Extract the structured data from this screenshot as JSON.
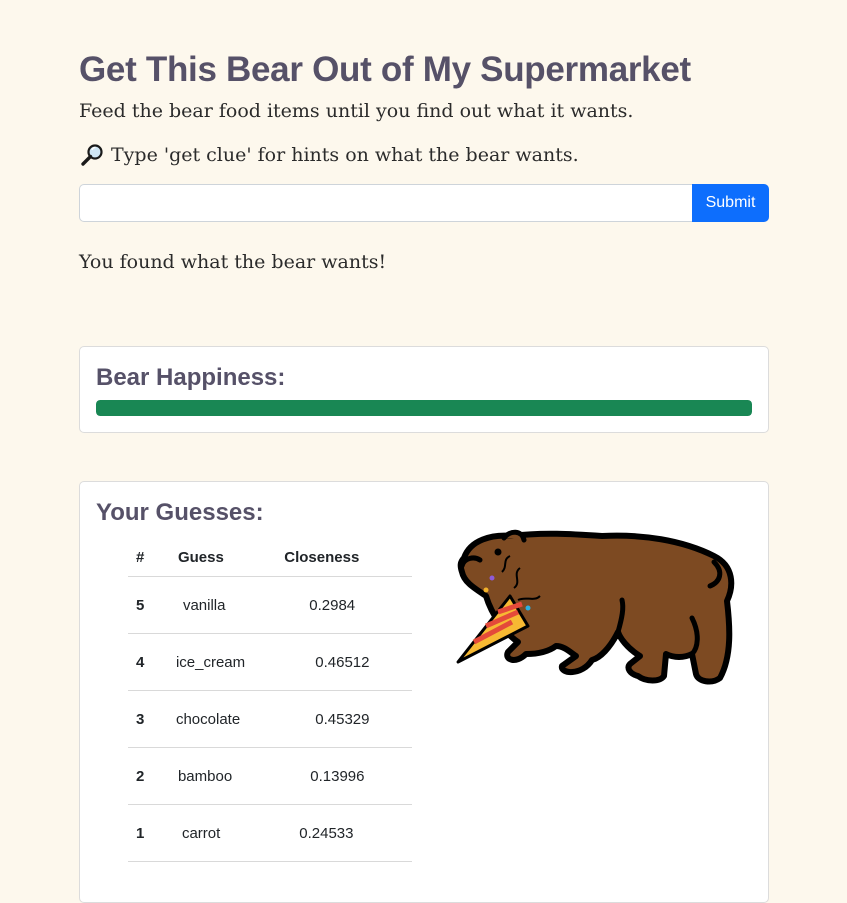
{
  "page": {
    "title": "Get This Bear Out of My Supermarket",
    "subtitle": "Feed the bear food items until you find out what it wants.",
    "clue_text": "Type 'get clue' for hints on what the bear wants.",
    "clue_icon": "magnifying-glass-icon"
  },
  "form": {
    "input_value": "",
    "input_placeholder": "",
    "submit_label": "Submit"
  },
  "status_message": "You found what the bear wants!",
  "happiness": {
    "heading": "Bear Happiness:",
    "level_percent": 100,
    "bar_color": "#198754"
  },
  "guesses": {
    "heading": "Your Guesses:",
    "columns": [
      "#",
      "Guess",
      "Closeness"
    ],
    "rows": [
      {
        "num": "5",
        "guess": "vanilla",
        "closeness": "0.2984"
      },
      {
        "num": "4",
        "guess": "ice_cream",
        "closeness": "0.46512"
      },
      {
        "num": "3",
        "guess": "chocolate",
        "closeness": "0.45329"
      },
      {
        "num": "2",
        "guess": "bamboo",
        "closeness": "0.13996"
      },
      {
        "num": "1",
        "guess": "carrot",
        "closeness": "0.24533"
      }
    ],
    "illustration": "bear-with-party-horn-icon"
  },
  "colors": {
    "background": "#fdf8ed",
    "heading": "#565168",
    "accent_button": "#0d6efd"
  }
}
